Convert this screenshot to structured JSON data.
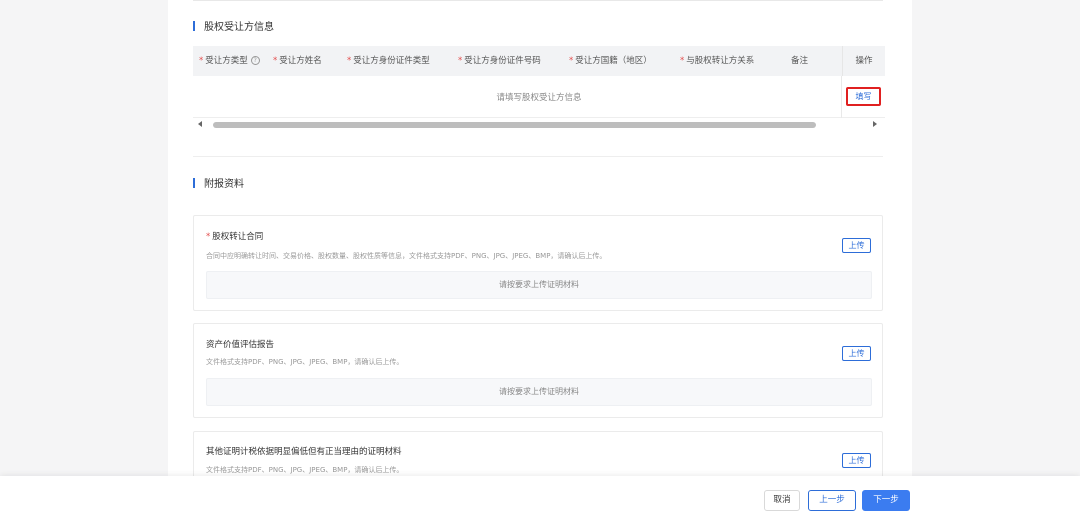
{
  "transferee_section": {
    "title": "股权受让方信息",
    "columns": [
      {
        "label": "受让方类型",
        "required": true,
        "help": true
      },
      {
        "label": "受让方姓名",
        "required": true
      },
      {
        "label": "受让方身份证件类型",
        "required": true
      },
      {
        "label": "受让方身份证件号码",
        "required": true
      },
      {
        "label": "受让方国籍（地区）",
        "required": true
      },
      {
        "label": "与股权转让方关系",
        "required": true
      },
      {
        "label": "备注",
        "required": false
      }
    ],
    "op_header": "操作",
    "empty_message": "请填写股权受让方信息",
    "fill_button": "填写"
  },
  "attachments_section": {
    "title": "附报资料",
    "items": [
      {
        "title": "股权转让合同",
        "required": true,
        "desc": "合同中应明确转让时间、交易价格、股权数量、股权性质等信息，文件格式支持PDF、PNG、JPG、JPEG、BMP，请确认后上传。",
        "upload_label": "上传",
        "drop_text": "请按要求上传证明材料"
      },
      {
        "title": "资产价值评估报告",
        "required": false,
        "desc": "文件格式支持PDF、PNG、JPG、JPEG、BMP，请确认后上传。",
        "upload_label": "上传",
        "drop_text": "请按要求上传证明材料"
      },
      {
        "title": "其他证明计税依据明显偏低但有正当理由的证明材料",
        "required": false,
        "desc": "文件格式支持PDF、PNG、JPG、JPEG、BMP，请确认后上传。",
        "upload_label": "上传",
        "drop_text": ""
      }
    ]
  },
  "footer": {
    "cancel": "取消",
    "prev": "上一步",
    "next": "下一步"
  },
  "colors": {
    "accent": "#2d6dd8",
    "primary_button": "#3b7cf0",
    "required_star": "#e34d4d",
    "highlight_box": "#e02020"
  }
}
